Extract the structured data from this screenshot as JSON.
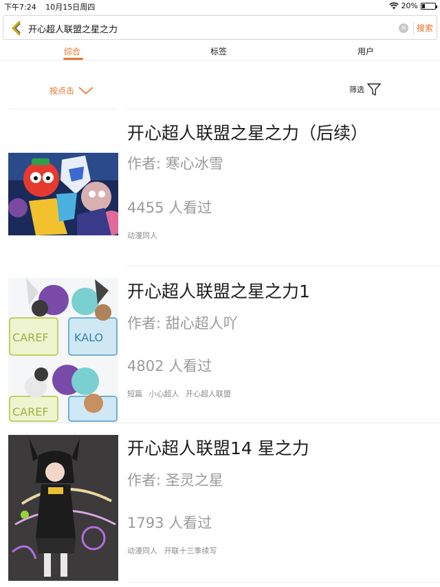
{
  "status": {
    "time": "下午7:24",
    "date": "10月15日周四",
    "battery": "20%",
    "battery_level": 0.2
  },
  "search": {
    "query": "开心超人联盟之星之力",
    "button_label": "搜索"
  },
  "tabs": [
    {
      "label": "综合",
      "active": true
    },
    {
      "label": "标签",
      "active": false
    },
    {
      "label": "用户",
      "active": false
    }
  ],
  "sort": {
    "label": "按点击"
  },
  "filter": {
    "label": "筛选"
  },
  "results": [
    {
      "title": "开心超人联盟之星之力（后续）",
      "author": "作者: 寒心冰雪",
      "views": "4455 人看过",
      "tags": [
        "动漫同人"
      ]
    },
    {
      "title": "开心超人联盟之星之力1",
      "author": "作者: 甜心超人吖",
      "views": "4802 人看过",
      "tags": [
        "短篇",
        "小心超人",
        "开心超人联盟"
      ]
    },
    {
      "title": "开心超人联盟14 星之力",
      "author": "作者: 圣灵之星",
      "views": "1793 人看过",
      "tags": [
        "动漫同人",
        "开联十三季续写"
      ]
    }
  ],
  "colors": {
    "accent": "#e8742a",
    "muted": "#9a9a9a"
  }
}
